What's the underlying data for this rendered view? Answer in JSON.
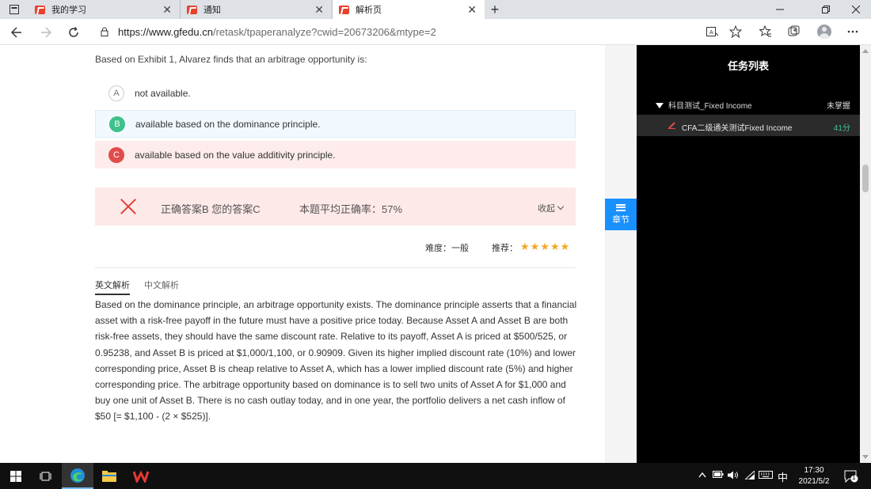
{
  "browser": {
    "tabs": [
      {
        "label": "我的学习",
        "close": "✕"
      },
      {
        "label": "通知",
        "close": "✕"
      },
      {
        "label": "解析页",
        "close": "✕"
      }
    ],
    "new_tab": "+",
    "url_host": "https://www.gfedu.cn",
    "url_rest": "/retask/tpaperanalyze?cwid=20673206&mtype=2"
  },
  "question": {
    "stem": "Based on Exhibit 1, Alvarez finds that an arbitrage opportunity is:",
    "options": [
      {
        "letter": "A",
        "text": "not available."
      },
      {
        "letter": "B",
        "text": "available based on the dominance principle."
      },
      {
        "letter": "C",
        "text": "available based on the value additivity principle."
      }
    ]
  },
  "result": {
    "answers": "正确答案B 您的答案C",
    "avg": "本题平均正确率：57%",
    "collapse": "收起"
  },
  "meta": {
    "difficulty": "难度：一般",
    "recommend": "推荐：",
    "stars": 5
  },
  "explanation": {
    "tab_en": "英文解析",
    "tab_cn": "中文解析",
    "text": "Based on the dominance principle, an arbitrage opportunity exists. The dominance principle asserts that a financial asset with a risk-free payoff in the future must have a positive price today. Because Asset A and Asset B are both risk-free assets, they should have the same discount rate. Relative to its payoff, Asset A is priced at $500/525, or 0.95238, and Asset B is priced at $1,000/1,100, or 0.90909. Given its higher implied discount rate (10%) and lower corresponding price, Asset B is cheap relative to Asset A, which has a lower implied discount rate (5%) and higher corresponding price. The arbitrage opportunity based on dominance is to sell two units of Asset A for $1,000 and buy one unit of Asset B. There is no cash outlay today, and in one year, the portfolio delivers a net cash inflow of $50 [= $1,100 - (2 × $525)]."
  },
  "panel": {
    "title": "任务列表",
    "section": "科目测试_Fixed Income",
    "status": "未掌握",
    "item_name": "CFA二级通关测试Fixed Income",
    "item_score": "41分"
  },
  "chapter_button": "章节",
  "taskbar": {
    "ime": "中",
    "time": "17:30",
    "date": "2021/5/2",
    "notifications": "1"
  },
  "colors": {
    "accent": "#1890ff",
    "correct": "#3ec18a",
    "wrong": "#e24b4b",
    "star": "#f5a623"
  }
}
